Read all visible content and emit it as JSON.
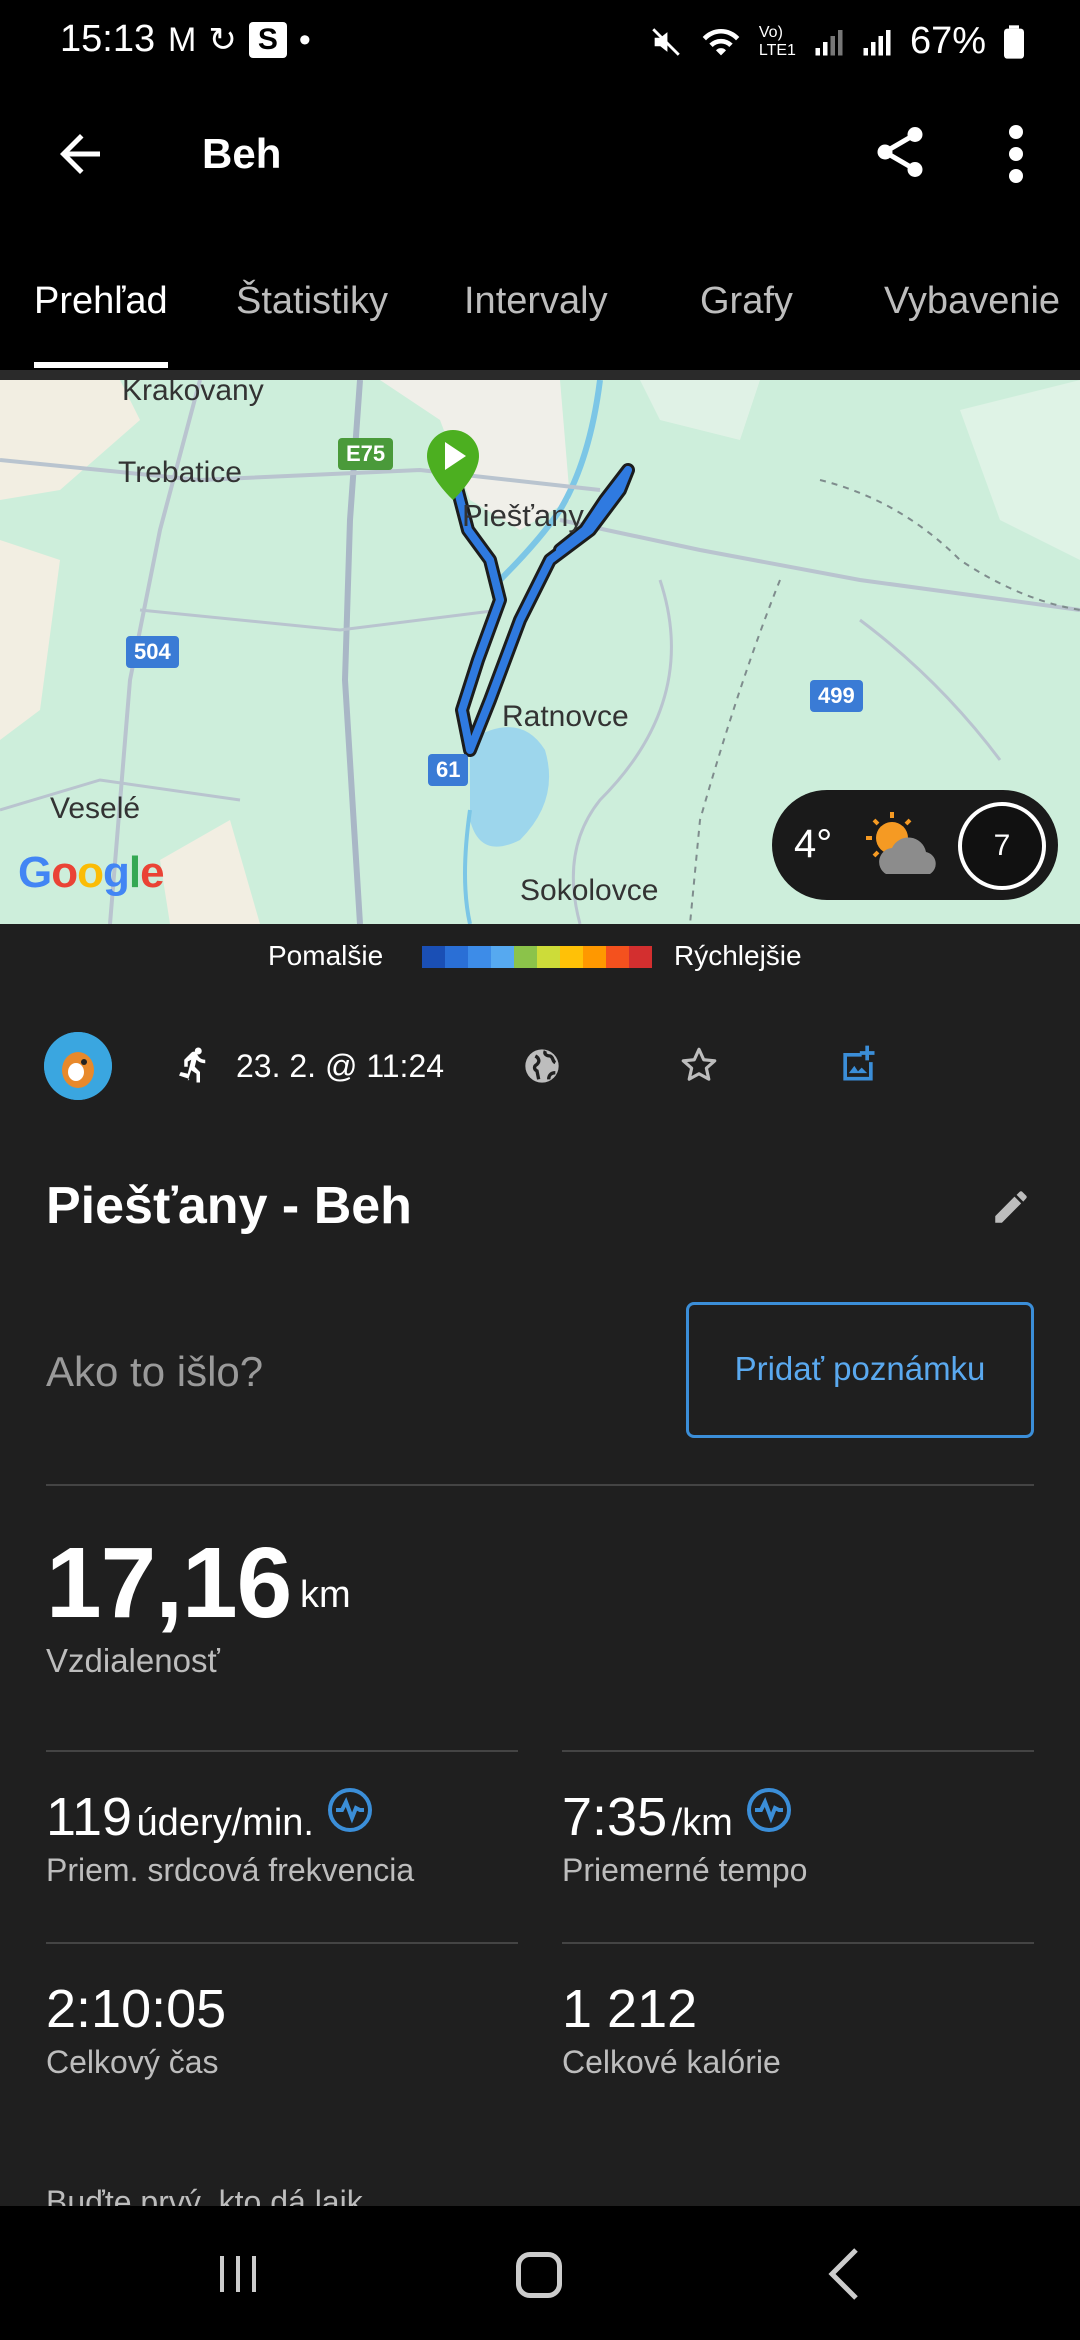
{
  "status_bar": {
    "time": "15:13",
    "battery": "67%"
  },
  "app_bar": {
    "title": "Beh"
  },
  "tabs": [
    {
      "label": "Prehľad",
      "active": true
    },
    {
      "label": "Štatistiky",
      "active": false
    },
    {
      "label": "Intervaly",
      "active": false
    },
    {
      "label": "Grafy",
      "active": false
    },
    {
      "label": "Vybavenie",
      "active": false
    }
  ],
  "map": {
    "labels": {
      "krakovany": "Krakovany",
      "trebatice": "Trebatice",
      "piestany": "Piešťany",
      "ratnovce": "Ratnovce",
      "vesele": "Veselé",
      "sokolovce": "Sokolovce"
    },
    "road_badges": {
      "e75": "E75",
      "r504": "504",
      "r499": "499",
      "r61": "61"
    },
    "attribution": "Google",
    "weather": {
      "temperature": "4°",
      "wind": "7"
    }
  },
  "speed_legend": {
    "slower": "Pomalšie",
    "faster": "Rýchlejšie",
    "colors": [
      "#1a4fb5",
      "#2a6fd6",
      "#3d8ce8",
      "#56a9f0",
      "#8bc34a",
      "#cddc39",
      "#ffc107",
      "#ff9800",
      "#f4511e",
      "#d32f2f"
    ]
  },
  "activity": {
    "datetime": "23. 2. @ 11:24",
    "title": "Piešťany - Beh",
    "prompt": "Ako to išlo?",
    "add_note_button": "Pridať poznámku",
    "distance": {
      "value": "17,16",
      "unit": "km",
      "label": "Vzdialenosť"
    },
    "heart_rate": {
      "value": "119",
      "unit": "údery/min.",
      "label": "Priem. srdcová frekvencia"
    },
    "pace": {
      "value": "7:35",
      "unit": "/km",
      "label": "Priemerné tempo"
    },
    "total_time": {
      "value": "2:10:05",
      "label": "Celkový čas"
    },
    "calories": {
      "value": "1 212",
      "label": "Celkové kalórie"
    },
    "likes": "Buďte prvý, kto dá lajk"
  },
  "colors": {
    "accent": "#3b8ed8",
    "background": "#1f1f1f",
    "map_bg": "#cdeedb",
    "route": "#2f7ae0",
    "start_marker": "#4caf20"
  }
}
